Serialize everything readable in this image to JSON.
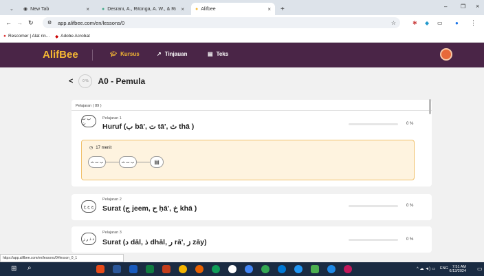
{
  "browser": {
    "tabs": [
      {
        "label": "New Tab",
        "active": false
      },
      {
        "label": "Desrani, A., Ritonga, A. W., & Ri",
        "active": false
      },
      {
        "label": "Alifbee",
        "active": true
      }
    ],
    "url": "app.alifbee.com/en/lessons/0",
    "bookmarks": [
      "Rescomer | Alat rin...",
      "Adobe Acrobat"
    ],
    "status_url": "https://app.alifbee.com/en/lessons/0#lesson_0_1"
  },
  "app": {
    "logo": "AlifBee",
    "nav": [
      {
        "label": "Kursus",
        "active": true
      },
      {
        "label": "Tinjauan",
        "active": false
      },
      {
        "label": "Teks",
        "active": false
      }
    ],
    "accent": "#f5b833",
    "nav_bg": "#4a2547"
  },
  "page": {
    "back_label": "<",
    "level_percent": "0 %",
    "title": "A0 - Pemula",
    "lessons_header": "Pelajaran ( 89 )"
  },
  "lessons": [
    {
      "label": "Pelajaran 1",
      "icon_text": "ﺏ ﺕ ﺙ",
      "title": "Huruf (ﺏ bā', ﺕ tā', ﺙ thā )",
      "progress": 0,
      "percent": "0 %"
    },
    {
      "label": "Pelajaran 2",
      "icon_text": "ﺝ ﺡ ﺥ",
      "title": "Surat (ﺝ jeem, ﺡ ḥā', ﺥ khā )",
      "progress": 0,
      "percent": "0 %"
    },
    {
      "label": "Pelajaran 3",
      "icon_text": "ﺩ ﺫ ﺭ ﺯ",
      "title": "Surat (ﺩ dāl, ﺫ dhāl, ﺭ rā', ﺯ zāy)",
      "progress": 0,
      "percent": "0 %"
    }
  ],
  "lesson_detail": {
    "duration": "17 menit",
    "steps": [
      "ﺏ ﺕ ﺙ",
      "ﺏ ﺕ ﺙ"
    ]
  },
  "taskbar": {
    "time": "7:51 AM",
    "date": "6/13/2024",
    "lang": "ENG"
  }
}
